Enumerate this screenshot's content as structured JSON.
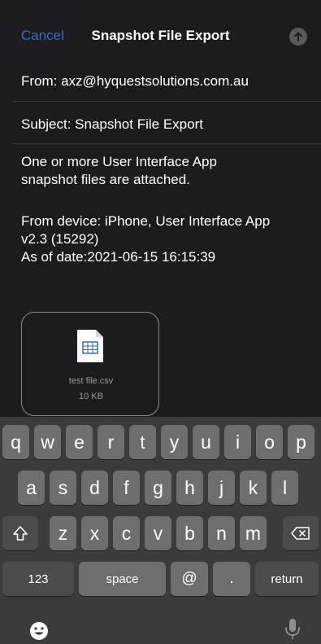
{
  "nav": {
    "cancel_label": "Cancel",
    "title": "Snapshot File Export",
    "send_icon": "arrow-up-icon"
  },
  "from": "From: axz@hyquestsolutions.com.au",
  "subject": "Subject: Snapshot File Export",
  "body": {
    "line1": "One or more User Interface App",
    "line2": "snapshot files are attached.",
    "line3": "From device: iPhone, User Interface App",
    "line4": "v2.3 (15292)",
    "line5": "As of date:2021-06-15  16:15:39"
  },
  "attachment": {
    "name": "test file.csv",
    "size": "10 KB"
  },
  "keyboard": {
    "row1": [
      "q",
      "w",
      "e",
      "r",
      "t",
      "y",
      "u",
      "i",
      "o",
      "p"
    ],
    "row2": [
      "a",
      "s",
      "d",
      "f",
      "g",
      "h",
      "j",
      "k",
      "l"
    ],
    "row3": [
      "z",
      "x",
      "c",
      "v",
      "b",
      "n",
      "m"
    ],
    "numbers_label": "123",
    "space_label": "space",
    "at_label": "@",
    "dot_label": ".",
    "return_label": "return"
  },
  "colors": {
    "accent": "#2f6fc9",
    "background": "#1c1c1e",
    "keyboard": "#3b3b3d"
  }
}
